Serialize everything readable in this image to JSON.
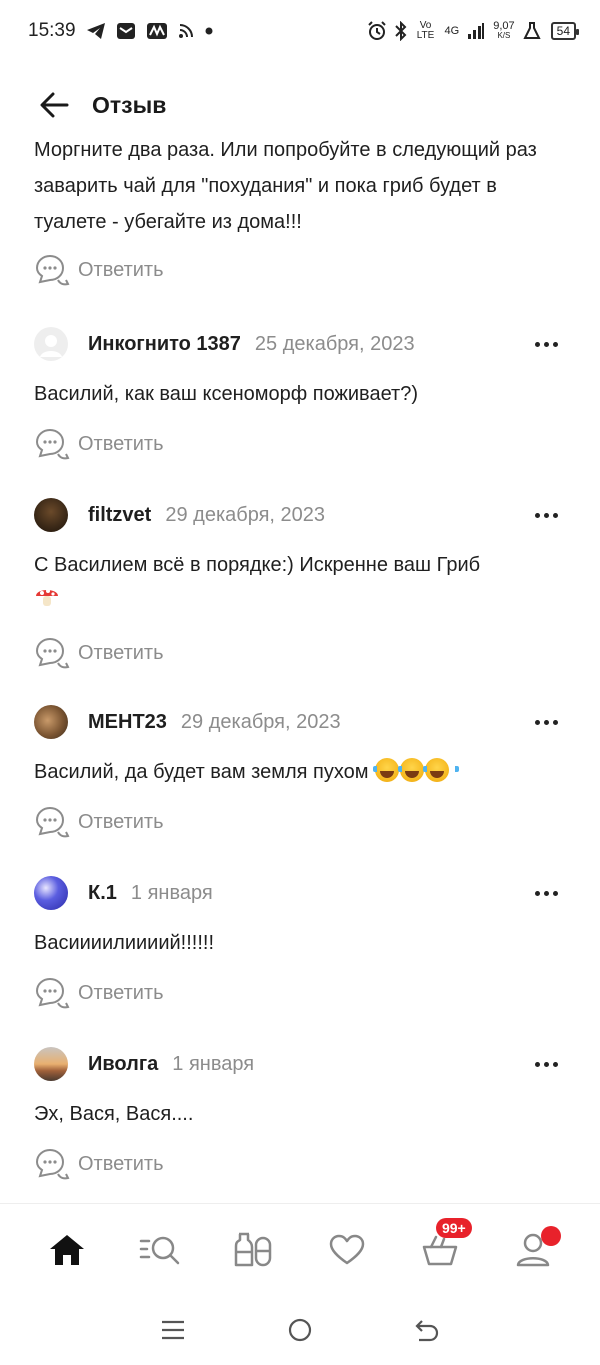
{
  "status_bar": {
    "time": "15:39",
    "net_speed_value": "9,07",
    "net_speed_unit": "K/S",
    "volte": "Vo LTE",
    "network": "4G",
    "battery": "54"
  },
  "header": {
    "title": "Отзыв"
  },
  "truncated_comment": {
    "text": "Моргните два раза. Или попробуйте в следующий раз заварить чай для \"похудания\" и пока гриб будет в туалете - убегайте из дома!!!",
    "reply_label": "Ответить"
  },
  "comments": [
    {
      "author": "Инкогнито 1387",
      "date": "25 декабря, 2023",
      "text": "Василий, как ваш ксеноморф поживает?)",
      "reply_label": "Ответить"
    },
    {
      "author": "filtzvet",
      "date": "29 декабря, 2023",
      "text": "С Василием всё в порядке:) Искренне ваш  Гриб",
      "reply_label": "Ответить"
    },
    {
      "author": "МЕНТ23",
      "date": "29 декабря, 2023",
      "text": "Василий, да будет вам земля пухом",
      "reply_label": "Ответить"
    },
    {
      "author": "К.1",
      "date": "1 января",
      "text": "Васиииилиииий!!!!!!",
      "reply_label": "Ответить"
    },
    {
      "author": "Иволга",
      "date": "1 января",
      "text": "Эх, Вася, Вася....",
      "reply_label": "Ответить"
    }
  ],
  "bottom_nav": {
    "items": [
      "home-icon",
      "catalog-search-icon",
      "compare-icon",
      "favorites-icon",
      "cart-icon",
      "profile-icon"
    ],
    "cart_badge": "99+"
  },
  "colors": {
    "accent_red": "#e8222b",
    "text_primary": "#1f1f1f",
    "text_secondary": "#8c8c8c"
  }
}
